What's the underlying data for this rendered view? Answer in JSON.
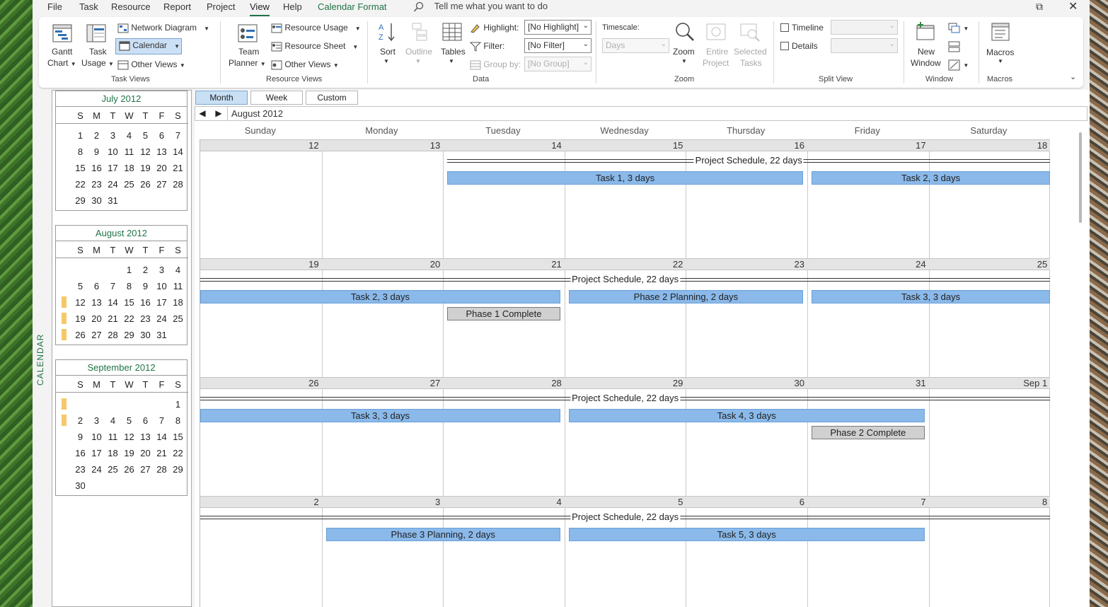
{
  "menu": {
    "file": "File",
    "task": "Task",
    "resource": "Resource",
    "report": "Report",
    "project": "Project",
    "view": "View",
    "help": "Help",
    "calendar_format": "Calendar Format",
    "tell_me": "Tell me what you want to do"
  },
  "ribbon": {
    "task_views": {
      "gantt": "Gantt",
      "gantt2": "Chart",
      "task_usage": "Task",
      "task_usage2": "Usage",
      "network_diagram": "Network Diagram",
      "calendar": "Calendar",
      "other_views": "Other Views",
      "label": "Task Views"
    },
    "resource_views": {
      "team_planner": "Team",
      "team_planner2": "Planner",
      "resource_usage": "Resource Usage",
      "resource_sheet": "Resource Sheet",
      "other_views": "Other Views",
      "label": "Resource Views"
    },
    "data": {
      "sort": "Sort",
      "outline": "Outline",
      "tables": "Tables",
      "highlight_label": "Highlight:",
      "highlight_value": "[No Highlight]",
      "filter_label": "Filter:",
      "filter_value": "[No Filter]",
      "groupby_label": "Group by:",
      "groupby_value": "[No Group]",
      "label": "Data"
    },
    "zoom": {
      "timescale_label": "Timescale:",
      "timescale_value": "Days",
      "zoom": "Zoom",
      "entire": "Entire",
      "entire2": "Project",
      "selected": "Selected",
      "selected2": "Tasks",
      "label": "Zoom"
    },
    "split": {
      "timeline": "Timeline",
      "details": "Details",
      "label": "Split View"
    },
    "window": {
      "new": "New",
      "new2": "Window",
      "label": "Window"
    },
    "macros": {
      "macros": "Macros",
      "label": "Macros"
    }
  },
  "sidebar_label": "CALENDAR",
  "mini_calendars": [
    {
      "title": "July 2012",
      "dow": [
        "S",
        "M",
        "T",
        "W",
        "T",
        "F",
        "S"
      ],
      "weeks": [
        [
          "1",
          "2",
          "3",
          "4",
          "5",
          "6",
          "7"
        ],
        [
          "8",
          "9",
          "10",
          "11",
          "12",
          "13",
          "14"
        ],
        [
          "15",
          "16",
          "17",
          "18",
          "19",
          "20",
          "21"
        ],
        [
          "22",
          "23",
          "24",
          "25",
          "26",
          "27",
          "28"
        ],
        [
          "29",
          "30",
          "31",
          "",
          "",
          "",
          ""
        ]
      ],
      "marked": [
        false,
        false,
        false,
        false,
        false
      ]
    },
    {
      "title": "August 2012",
      "dow": [
        "S",
        "M",
        "T",
        "W",
        "T",
        "F",
        "S"
      ],
      "weeks": [
        [
          "",
          "",
          "",
          "1",
          "2",
          "3",
          "4"
        ],
        [
          "5",
          "6",
          "7",
          "8",
          "9",
          "10",
          "11"
        ],
        [
          "12",
          "13",
          "14",
          "15",
          "16",
          "17",
          "18"
        ],
        [
          "19",
          "20",
          "21",
          "22",
          "23",
          "24",
          "25"
        ],
        [
          "26",
          "27",
          "28",
          "29",
          "30",
          "31",
          ""
        ]
      ],
      "marked": [
        false,
        false,
        true,
        true,
        true
      ]
    },
    {
      "title": "September 2012",
      "dow": [
        "S",
        "M",
        "T",
        "W",
        "T",
        "F",
        "S"
      ],
      "weeks": [
        [
          "",
          "",
          "",
          "",
          "",
          "",
          "1"
        ],
        [
          "2",
          "3",
          "4",
          "5",
          "6",
          "7",
          "8"
        ],
        [
          "9",
          "10",
          "11",
          "12",
          "13",
          "14",
          "15"
        ],
        [
          "16",
          "17",
          "18",
          "19",
          "20",
          "21",
          "22"
        ],
        [
          "23",
          "24",
          "25",
          "26",
          "27",
          "28",
          "29"
        ],
        [
          "30",
          "",
          "",
          "",
          "",
          "",
          ""
        ]
      ],
      "marked": [
        true,
        true,
        false,
        false,
        false,
        false
      ]
    }
  ],
  "view_tabs": {
    "month": "Month",
    "week": "Week",
    "custom": "Custom"
  },
  "nav": {
    "prev": "◀",
    "next": "▶",
    "month_label": "August 2012"
  },
  "dow_headers": [
    "Sunday",
    "Monday",
    "Tuesday",
    "Wednesday",
    "Thursday",
    "Friday",
    "Saturday"
  ],
  "weeks": [
    {
      "days": [
        "12",
        "13",
        "14",
        "15",
        "16",
        "17",
        "18"
      ],
      "project": {
        "label": "Project Schedule, 22 days",
        "start": 2,
        "end": 7
      },
      "bars": [
        {
          "label": "Task 1, 3 days",
          "start": 2,
          "end": 5,
          "row": 0,
          "kind": "task"
        },
        {
          "label": "Task 2, 3 days",
          "start": 5,
          "end": 7,
          "row": 0,
          "kind": "task"
        }
      ]
    },
    {
      "days": [
        "19",
        "20",
        "21",
        "22",
        "23",
        "24",
        "25"
      ],
      "project": {
        "label": "Project Schedule, 22 days",
        "start": 0,
        "end": 7
      },
      "bars": [
        {
          "label": "Task 2, 3 days",
          "start": 0,
          "end": 3,
          "row": 0,
          "kind": "task"
        },
        {
          "label": "Phase 2 Planning, 2 days",
          "start": 3,
          "end": 5,
          "row": 0,
          "kind": "task"
        },
        {
          "label": "Task 3, 3 days",
          "start": 5,
          "end": 7,
          "row": 0,
          "kind": "task"
        },
        {
          "label": "Phase 1 Complete",
          "start": 2,
          "end": 3,
          "row": 1,
          "kind": "milestone"
        }
      ]
    },
    {
      "days": [
        "26",
        "27",
        "28",
        "29",
        "30",
        "31",
        "Sep 1"
      ],
      "project": {
        "label": "Project Schedule, 22 days",
        "start": 0,
        "end": 7
      },
      "bars": [
        {
          "label": "Task 3, 3 days",
          "start": 0,
          "end": 3,
          "row": 0,
          "kind": "task"
        },
        {
          "label": "Task 4, 3 days",
          "start": 3,
          "end": 6,
          "row": 0,
          "kind": "task"
        },
        {
          "label": "Phase 2 Complete",
          "start": 5,
          "end": 6,
          "row": 1,
          "kind": "milestone"
        }
      ]
    },
    {
      "days": [
        "2",
        "3",
        "4",
        "5",
        "6",
        "7",
        "8"
      ],
      "project": {
        "label": "Project Schedule, 22 days",
        "start": 0,
        "end": 7
      },
      "bars": [
        {
          "label": "Phase  3 Planning, 2 days",
          "start": 1,
          "end": 3,
          "row": 0,
          "kind": "task"
        },
        {
          "label": "Task 5, 3 days",
          "start": 3,
          "end": 6,
          "row": 0,
          "kind": "task"
        }
      ]
    }
  ]
}
